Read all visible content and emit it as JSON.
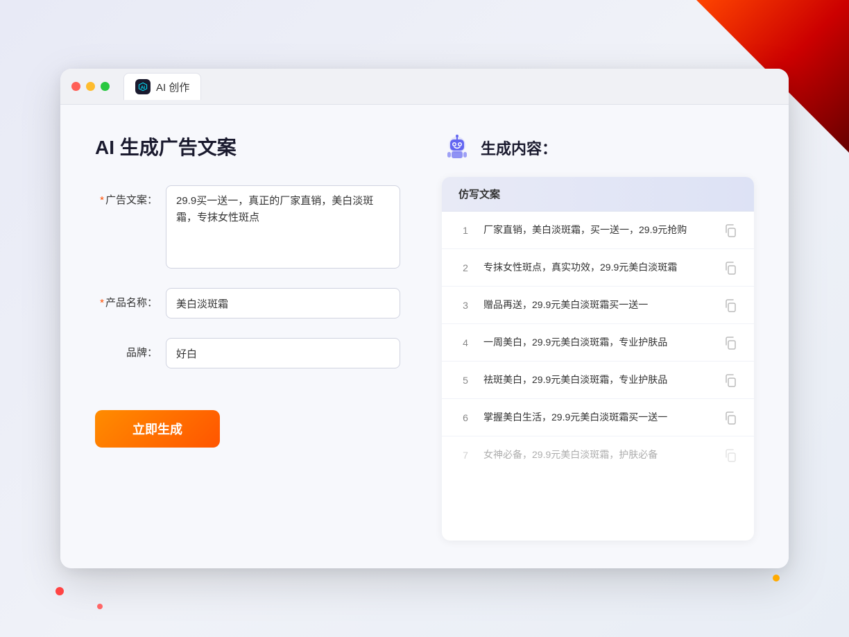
{
  "window": {
    "tab_title": "AI 创作"
  },
  "traffic_lights": {
    "red": "red",
    "yellow": "yellow",
    "green": "green"
  },
  "left_panel": {
    "page_title": "AI 生成广告文案",
    "form": {
      "ad_copy_label": "广告文案：",
      "ad_copy_required": "*",
      "ad_copy_value": "29.9买一送一，真正的厂家直销，美白淡斑霜，专抹女性斑点",
      "product_name_label": "产品名称：",
      "product_name_required": "*",
      "product_name_value": "美白淡斑霜",
      "brand_label": "品牌：",
      "brand_value": "好白",
      "generate_button": "立即生成"
    }
  },
  "right_panel": {
    "title": "生成内容：",
    "table_header": "仿写文案",
    "results": [
      {
        "num": "1",
        "text": "厂家直销，美白淡斑霜，买一送一，29.9元抢购",
        "faded": false
      },
      {
        "num": "2",
        "text": "专抹女性斑点，真实功效，29.9元美白淡斑霜",
        "faded": false
      },
      {
        "num": "3",
        "text": "赠品再送，29.9元美白淡斑霜买一送一",
        "faded": false
      },
      {
        "num": "4",
        "text": "一周美白，29.9元美白淡斑霜，专业护肤品",
        "faded": false
      },
      {
        "num": "5",
        "text": "祛斑美白，29.9元美白淡斑霜，专业护肤品",
        "faded": false
      },
      {
        "num": "6",
        "text": "掌握美白生活，29.9元美白淡斑霜买一送一",
        "faded": false
      },
      {
        "num": "7",
        "text": "女神必备，29.9元美白淡斑霜，护肤必备",
        "faded": true
      }
    ]
  }
}
